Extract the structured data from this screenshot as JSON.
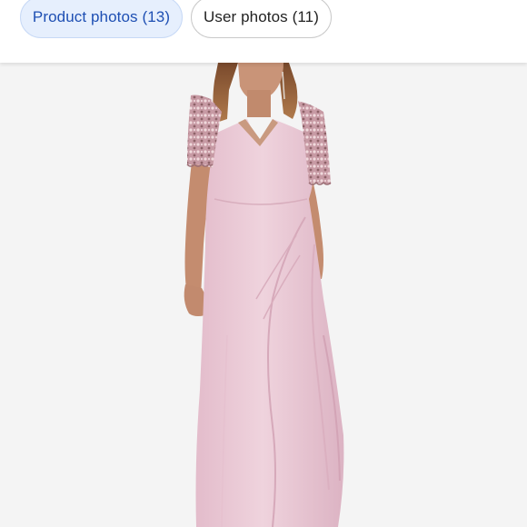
{
  "tabs": {
    "product_photos": "Product photos (13)",
    "user_photos": "User photos (11)"
  },
  "photo": {
    "subject": "model wearing blush pink gown with beaded short sleeves",
    "dress_color": "#ebc9d3",
    "background_color": "#f4f4f4"
  },
  "colors": {
    "accent": "#1e4fb3",
    "selected_chip_bg": "#e6effd"
  }
}
